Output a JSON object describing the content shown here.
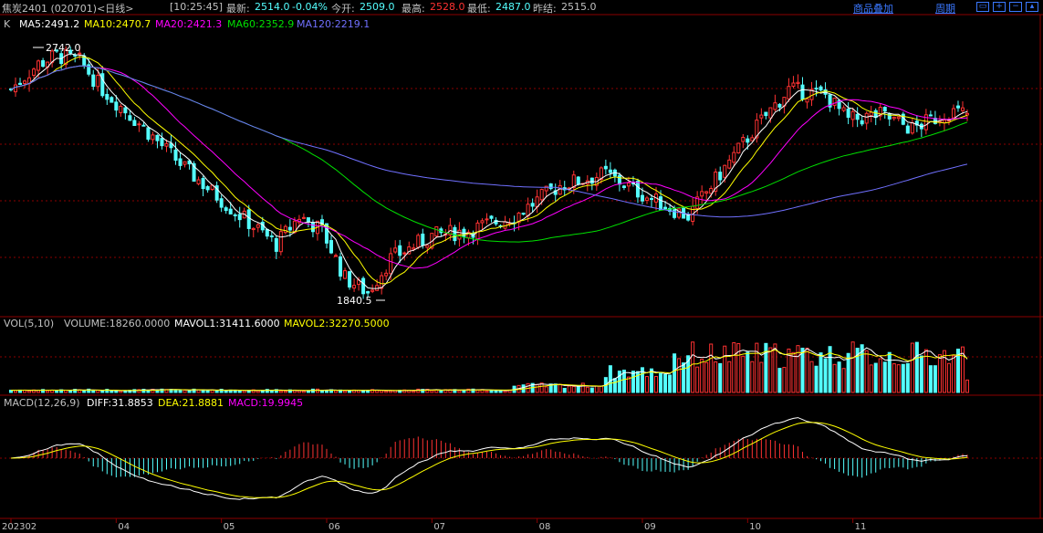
{
  "header": {
    "symbol": "焦炭2401 (020701)<日线>",
    "time": "[10:25:45]",
    "last_label": "最新:",
    "last": "2514.0",
    "change": "-0.04%",
    "open_label": "今开:",
    "open": "2509.0",
    "high_label": "最高:",
    "high": "2528.0",
    "low_label": "最低:",
    "low": "2487.0",
    "prev_label": "昨结:",
    "prev": "2515.0",
    "overlay_link": "商品叠加",
    "period_link": "周期"
  },
  "legend": {
    "k": "K",
    "ma5": "MA5:2491.2",
    "ma10": "MA10:2470.7",
    "ma20": "MA20:2421.3",
    "ma60": "MA60:2352.9",
    "ma120": "MA120:2219.1",
    "vol_name": "VOL(5,10)",
    "volume": "VOLUME:18260.0000",
    "mavol1": "MAVOL1:31411.6000",
    "mavol2": "MAVOL2:32270.5000",
    "macd_name": "MACD(12,26,9)",
    "diff": "DIFF:31.8853",
    "dea": "DEA:21.8881",
    "macd": "MACD:19.9945"
  },
  "annotations": {
    "high_mark": "2742.0",
    "low_mark": "1840.5"
  },
  "colors": {
    "up": "#ff3232",
    "down": "#54ffff",
    "ma5": "#ffffff",
    "ma10": "#ffff00",
    "ma20": "#ff00ff",
    "ma60": "#00e000",
    "ma120": "#7070ff",
    "grid": "#8b0000",
    "link": "#3a78ff"
  },
  "chart_data": {
    "type": "candlestick",
    "title": "焦炭2401 (020701)<日线>",
    "x_ticks": [
      "202302",
      "04",
      "05",
      "06",
      "07",
      "08",
      "09",
      "10",
      "11"
    ],
    "price_range": [
      1800,
      2800
    ],
    "price_anchors": [
      [
        0,
        2600
      ],
      [
        6,
        2690
      ],
      [
        10,
        2720
      ],
      [
        15,
        2700
      ],
      [
        20,
        2600
      ],
      [
        28,
        2480
      ],
      [
        38,
        2320
      ],
      [
        48,
        2180
      ],
      [
        58,
        2050
      ],
      [
        63,
        2150
      ],
      [
        68,
        2100
      ],
      [
        73,
        1930
      ],
      [
        78,
        1880
      ],
      [
        83,
        2000
      ],
      [
        92,
        2080
      ],
      [
        100,
        2100
      ],
      [
        110,
        2150
      ],
      [
        120,
        2260
      ],
      [
        130,
        2300
      ],
      [
        140,
        2210
      ],
      [
        148,
        2150
      ],
      [
        155,
        2300
      ],
      [
        162,
        2450
      ],
      [
        170,
        2600
      ],
      [
        178,
        2580
      ],
      [
        183,
        2490
      ],
      [
        190,
        2510
      ],
      [
        197,
        2460
      ],
      [
        205,
        2520
      ],
      [
        210,
        2514
      ]
    ],
    "volume_range": [
      0,
      90000
    ],
    "macd_range": [
      -110,
      110
    ],
    "last": {
      "open": 2509.0,
      "high": 2528.0,
      "low": 2487.0,
      "close": 2514.0,
      "volume": 18260
    },
    "ma": {
      "MA5": 2491.2,
      "MA10": 2470.7,
      "MA20": 2421.3,
      "MA60": 2352.9,
      "MA120": 2219.1
    },
    "mavol": {
      "MAVOL1": 31411.6,
      "MAVOL2": 32270.5
    },
    "macd_values": {
      "DIFF": 31.8853,
      "DEA": 21.8881,
      "MACD": 19.9945
    },
    "extremes": {
      "high": 2742.0,
      "low": 1840.5
    },
    "bars": 210
  }
}
